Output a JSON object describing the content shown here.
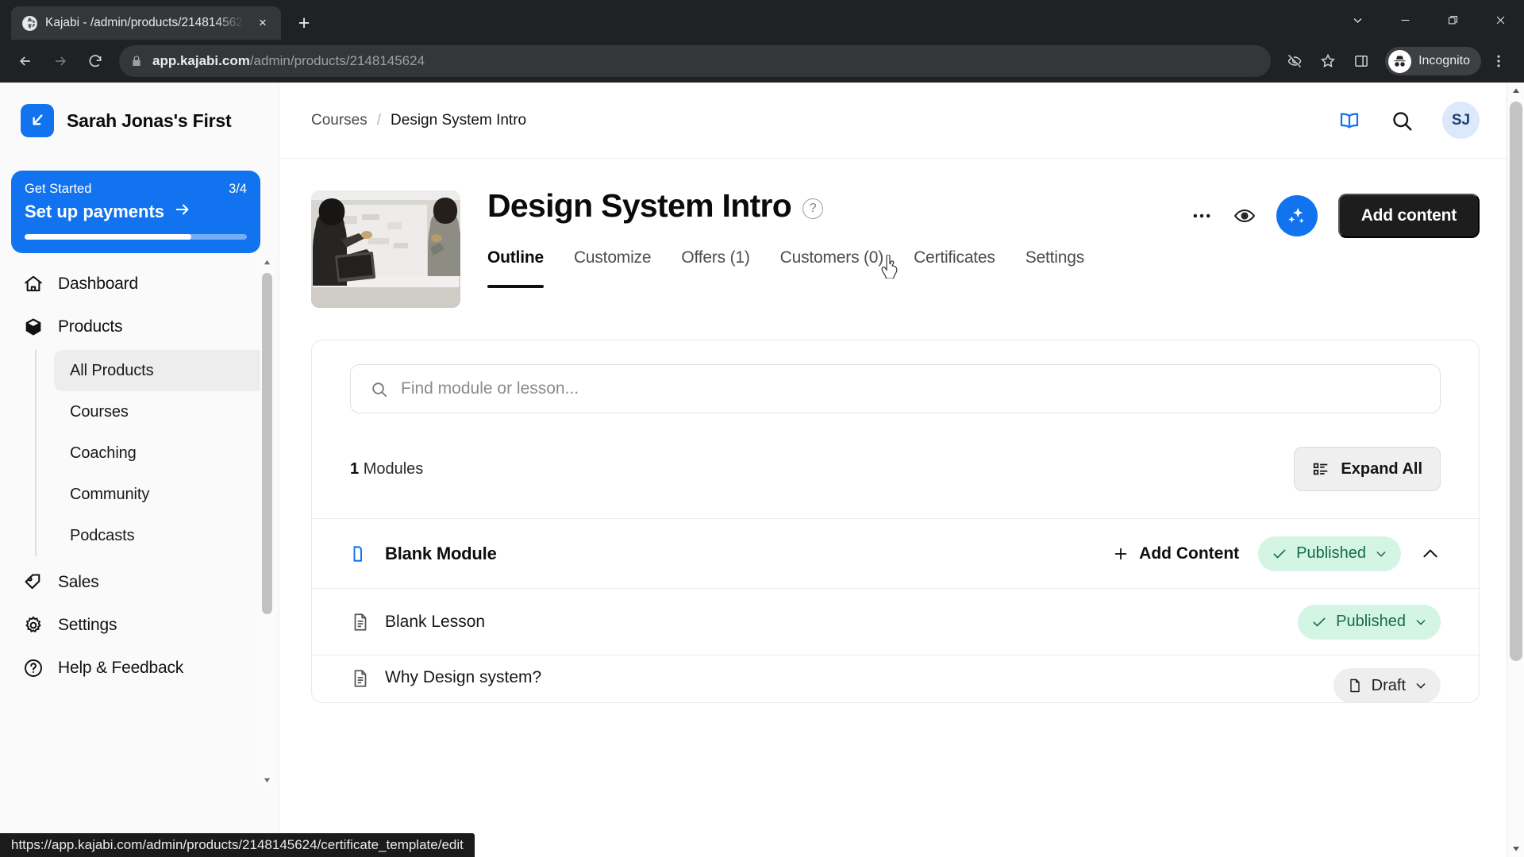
{
  "browser": {
    "tab": {
      "title": "Kajabi - /admin/products/2148145624",
      "favicon": "globe-icon",
      "close": "×"
    },
    "newtab_label": "+",
    "window_controls": [
      "tab-search-icon",
      "minimize-icon",
      "maximize-icon",
      "close-icon"
    ],
    "nav": {
      "back": "back-icon",
      "forward": "forward-icon",
      "reload": "reload-icon"
    },
    "omnibox": {
      "lock": "lock-icon",
      "host": "app.kajabi.com",
      "path": "/admin/products/2148145624"
    },
    "actions": {
      "not_tracking": "eye-slash-icon",
      "bookmark": "star-icon",
      "side_panel": "side-panel-icon",
      "menu": "kebab-menu-icon"
    },
    "incognito": {
      "label": "Incognito",
      "icon": "incognito-icon"
    },
    "status_url": "https://app.kajabi.com/admin/products/2148145624/certificate_template/edit"
  },
  "sidebar": {
    "brand": {
      "name": "Sarah Jonas's First",
      "logo": "kajabi-logo-icon"
    },
    "get_started": {
      "title": "Get Started",
      "count": "3/4",
      "action": "Set up payments",
      "arrow": "arrow-right-icon",
      "progress_percent": 75
    },
    "items": [
      {
        "label": "Dashboard",
        "icon": "home-icon"
      },
      {
        "label": "Products",
        "icon": "box-icon"
      },
      {
        "label": "Sales",
        "icon": "tag-icon"
      },
      {
        "label": "Settings",
        "icon": "gear-icon"
      },
      {
        "label": "Help & Feedback",
        "icon": "question-circle-icon"
      }
    ],
    "sub_items": [
      {
        "label": "All Products",
        "active": true
      },
      {
        "label": "Courses",
        "active": false
      },
      {
        "label": "Coaching",
        "active": false
      },
      {
        "label": "Community",
        "active": false
      },
      {
        "label": "Podcasts",
        "active": false
      }
    ]
  },
  "topbar": {
    "breadcrumb": {
      "parent": "Courses",
      "separator": "/",
      "current": "Design System Intro"
    },
    "library_icon": "book-icon",
    "search_icon": "search-icon",
    "avatar_initials": "SJ"
  },
  "product": {
    "title": "Design System Intro",
    "help_glyph": "?",
    "thumbnail": "course-thumbnail-photo",
    "actions": {
      "more": "ellipsis-icon",
      "preview": "eye-icon",
      "ai": "sparkles-icon",
      "add_content": "Add content"
    },
    "tabs": [
      {
        "label": "Outline",
        "active": true
      },
      {
        "label": "Customize",
        "active": false
      },
      {
        "label": "Offers (1)",
        "active": false
      },
      {
        "label": "Customers (0)",
        "active": false
      },
      {
        "label": "Certificates",
        "active": false
      },
      {
        "label": "Settings",
        "active": false
      }
    ]
  },
  "outline": {
    "search_placeholder": "Find module or lesson...",
    "search_value": "",
    "search_icon": "search-icon",
    "module_count_number": "1",
    "module_count_label": "Modules",
    "expand_all": {
      "label": "Expand All",
      "icon": "list-icon"
    },
    "rows": [
      {
        "type": "module",
        "title": "Blank Module",
        "icon": "folder-icon",
        "add_content_label": "Add Content",
        "add_content_icon": "plus-icon",
        "status": "Published",
        "status_icon": "check-icon",
        "chevron": "chevron-down-icon",
        "collapse_icon": "chevron-up-icon"
      },
      {
        "type": "lesson",
        "title": "Blank Lesson",
        "icon": "document-icon",
        "status": "Published",
        "status_icon": "check-icon",
        "chevron": "chevron-down-icon"
      },
      {
        "type": "lesson",
        "title": "Why Design system?",
        "icon": "document-icon",
        "status": "Draft",
        "status_icon": "page-icon",
        "chevron": "chevron-down-icon"
      }
    ]
  },
  "colors": {
    "brand_blue": "#1173f0",
    "dark_button": "#1d1d1d",
    "published_bg": "#d4f5e3",
    "published_text": "#156c44",
    "draft_bg": "#eeeeee",
    "avatar_bg": "#dce9fb"
  }
}
